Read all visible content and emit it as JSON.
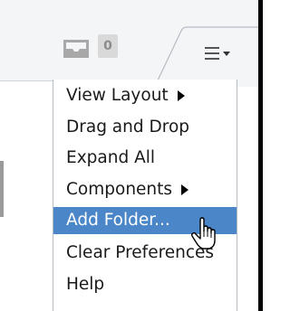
{
  "toolbar": {
    "inbox_icon": "inbox-tray-icon",
    "count_badge": "0",
    "menu_icon": "hamburger-menu-with-chevron-icon"
  },
  "menu": {
    "items": [
      {
        "label": "View Layout",
        "has_submenu": true,
        "highlighted": false
      },
      {
        "label": "Drag and Drop",
        "has_submenu": false,
        "highlighted": false
      },
      {
        "label": "Expand All",
        "has_submenu": false,
        "highlighted": false
      },
      {
        "label": "Components",
        "has_submenu": true,
        "highlighted": false
      },
      {
        "label": "Add Folder...",
        "has_submenu": false,
        "highlighted": true
      },
      {
        "label": "Clear Preferences",
        "has_submenu": false,
        "highlighted": false
      },
      {
        "label": "Help",
        "has_submenu": false,
        "highlighted": false
      }
    ]
  },
  "colors": {
    "highlight": "#4a86c8",
    "toolbar_bg": "#f4f5f7",
    "badge_bg": "#d9d9d9"
  },
  "cursor": "hand-pointer-icon"
}
